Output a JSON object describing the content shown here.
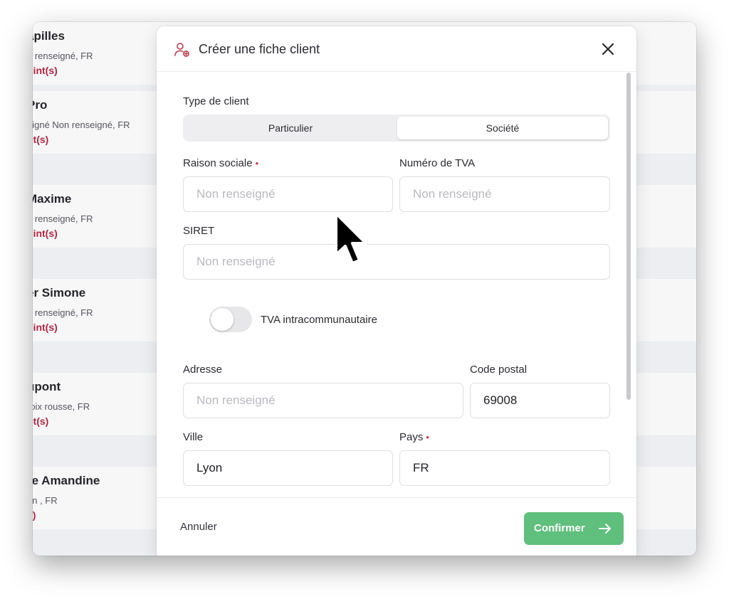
{
  "background_list": {
    "items": [
      {
        "name": "apilles",
        "sub": "n renseigné, FR",
        "points": "oint(s)"
      },
      {
        "name": "Pro",
        "sub": "eigné Non renseigné, FR",
        "points": "nt(s)"
      },
      {
        "name": "Maxime",
        "sub": "n renseigné, FR",
        "points": "oint(s)"
      },
      {
        "name": "er Simone",
        "sub": "n renseigné, FR",
        "points": "oint(s)"
      },
      {
        "name": "upont",
        "sub": "roix rousse, FR",
        "points": "nt(s)"
      },
      {
        "name": "re Amandine",
        "sub": "on , FR",
        "points": "s)"
      }
    ]
  },
  "modal": {
    "title": "Créer une fiche client",
    "client_type": {
      "label": "Type de client",
      "options": [
        "Particulier",
        "Société"
      ],
      "selected": "Société"
    },
    "fields": {
      "raison_sociale": {
        "label": "Raison sociale",
        "required_mark": "•",
        "placeholder": "Non renseigné",
        "value": ""
      },
      "numero_tva": {
        "label": "Numéro de TVA",
        "placeholder": "Non renseigné",
        "value": ""
      },
      "siret": {
        "label": "SIRET",
        "placeholder": "Non renseigné",
        "value": ""
      },
      "adresse": {
        "label": "Adresse",
        "placeholder": "Non renseigné",
        "value": ""
      },
      "code_postal": {
        "label": "Code postal",
        "value": "69008"
      },
      "ville": {
        "label": "Ville",
        "value": "Lyon"
      },
      "pays": {
        "label": "Pays",
        "required_mark": "•",
        "value": "FR"
      }
    },
    "tva_toggle": {
      "label": "TVA intracommunautaire",
      "on": false
    },
    "footer": {
      "cancel_label": "Annuler",
      "confirm_label": "Confirmer"
    }
  },
  "colors": {
    "accent_green": "#5fbf7c",
    "required_red": "#d0313f",
    "points_red": "#b3253f",
    "header_icon": "#c0394c"
  },
  "icons": {
    "header": "user-add-icon",
    "close": "close-icon",
    "confirm": "arrow-right-icon",
    "cursor": "mouse-pointer-icon"
  }
}
